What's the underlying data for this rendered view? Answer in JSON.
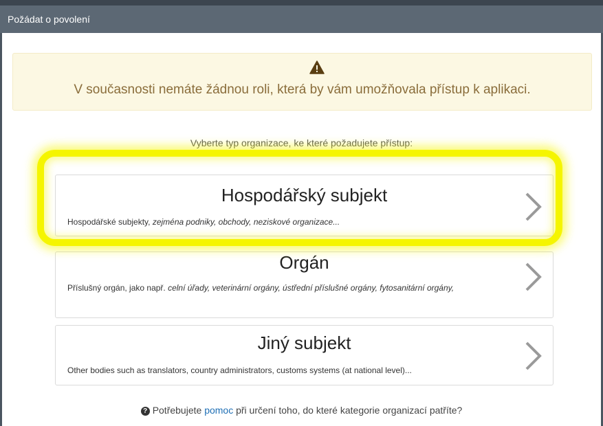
{
  "window": {
    "title": "Požádat o povolení"
  },
  "warning": {
    "icon": "warning-triangle-icon",
    "text": "V současnosti nemáte žádnou roli, která by vám umožňovala přístup k aplikaci."
  },
  "prompt": "Vyberte typ organizace, ke které požadujete přístup:",
  "cards": [
    {
      "title": "Hospodářský subjekt",
      "desc_plain": "Hospodářské subjekty, ",
      "desc_italic": "zejména podniky, obchody, neziskové organizace..."
    },
    {
      "title": "Orgán",
      "desc_plain": "Příslušný orgán, jako např. ",
      "desc_italic": "celní úřady, veterinární orgány, ústřední příslušné orgány, fytosanitární orgány,"
    },
    {
      "title": "Jiný subjekt",
      "desc_plain": "Other bodies such as translators, country administrators, customs systems (at national level)...",
      "desc_italic": ""
    }
  ],
  "help": {
    "before": "Potřebujete ",
    "link": "pomoc",
    "after": " při určení toho, do které kategorie organizací patříte?"
  },
  "colors": {
    "highlight": "#f5f500",
    "warning_text": "#8a6d3b",
    "link": "#1f6fb5"
  }
}
